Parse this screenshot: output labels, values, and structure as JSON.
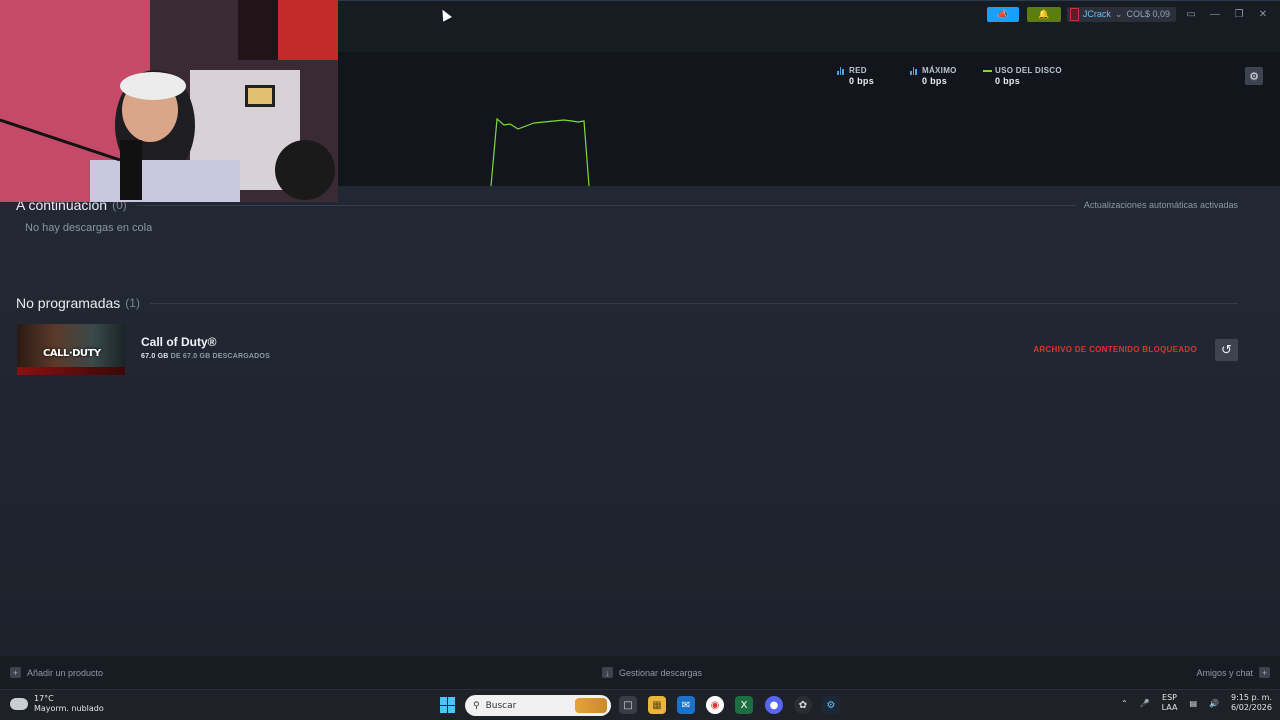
{
  "titlebar": {
    "announce_icon": "megaphone-icon",
    "notify_icon": "bell-icon",
    "user_name": "JCrack",
    "wallet": "COL$ 0,09"
  },
  "stats": {
    "network_label": "RED",
    "network_value": "0 bps",
    "peak_label": "MÁXIMO",
    "peak_value": "0 bps",
    "disk_label": "USO DEL DISCO",
    "disk_value": "0 bps",
    "colors": {
      "network": "#4aa3df",
      "disk": "#7bdc3a"
    }
  },
  "up_next": {
    "title": "A continuación",
    "count": "(0)",
    "auto_updates": "Actualizaciones automáticas activadas",
    "empty": "No hay descargas en cola"
  },
  "unscheduled": {
    "title": "No programadas",
    "count": "(1)",
    "items": [
      {
        "cover_text": "CALL·DUTY",
        "name": "Call of Duty®",
        "downloaded": "67.0 GB",
        "total_text": "DE 67.0 GB DESCARGADOS",
        "status": "ARCHIVO DE CONTENIDO BLOQUEADO",
        "status_color": "#e0322d"
      }
    ]
  },
  "bottom_bar": {
    "add_product": "Añadir un producto",
    "manage_downloads": "Gestionar descargas",
    "friends_chat": "Amigos y chat"
  },
  "taskbar": {
    "temperature": "17°C",
    "weather": "Mayorm. nublado",
    "search_placeholder": "Buscar",
    "lang_line1": "ESP",
    "lang_line2": "LAA",
    "time": "9:15 p. m.",
    "date": "6/02/2026"
  }
}
